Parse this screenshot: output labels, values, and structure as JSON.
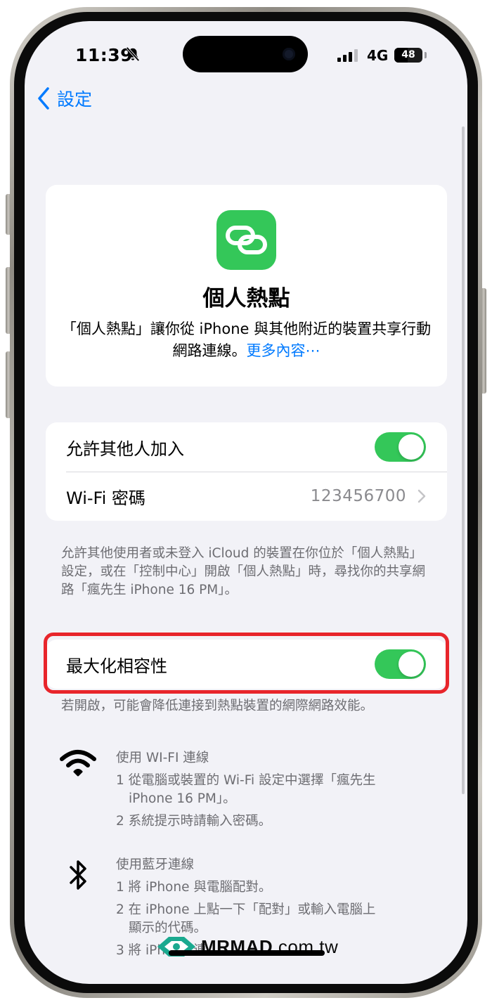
{
  "status_bar": {
    "time": "11:39",
    "network_type": "4G",
    "battery_level": "48",
    "battery_fraction": 0.48,
    "signal_bars": 3,
    "signal_bars_total": 4
  },
  "nav": {
    "back_label": "設定"
  },
  "hero": {
    "title": "個人熱點",
    "description": "「個人熱點」讓你從 iPhone 與其他附近的裝置共享行動網路連線。",
    "more_link": "更多內容⋯"
  },
  "settings_group": {
    "allow_others_label": "允許其他人加入",
    "allow_others_on": true,
    "wifi_password_label": "Wi-Fi 密碼",
    "wifi_password_value": "123456700"
  },
  "allow_footnote": "允許其他使用者或未登入 iCloud 的裝置在你位於「個人熱點」設定，或在「控制中心」開啟「個人熱點」時，尋找你的共享網路「瘋先生 iPhone 16 PM」。",
  "compat_group": {
    "max_compat_label": "最大化相容性",
    "max_compat_on": true
  },
  "compat_footnote": "若開啟，可能會降低連接到熱點裝置的網際網路效能。",
  "wifi_instructions": {
    "icon": "wifi-icon",
    "title": "使用 WI-FI 連線",
    "step1": "1 從電腦或裝置的 Wi-Fi 設定中選擇「瘋先生",
    "step1_cont": "iPhone 16 PM」。",
    "step2": "2 系統提示時請輸入密碼。"
  },
  "bluetooth_instructions": {
    "icon": "bluetooth-icon",
    "title": "使用藍牙連線",
    "step1": "1 將 iPhone 與電腦配對。",
    "step2": "2 在 iPhone 上點一下「配對」或輸入電腦上",
    "step2_cont": "顯示的代碼。",
    "step3": "3 將 iPhone 連"
  },
  "watermark": {
    "brand": "MRMAD",
    "domain": ".com.tw"
  },
  "colors": {
    "accent": "#007aff",
    "toggle_on": "#34c759",
    "highlight": "#e8252b",
    "background": "#f2f2f7"
  }
}
